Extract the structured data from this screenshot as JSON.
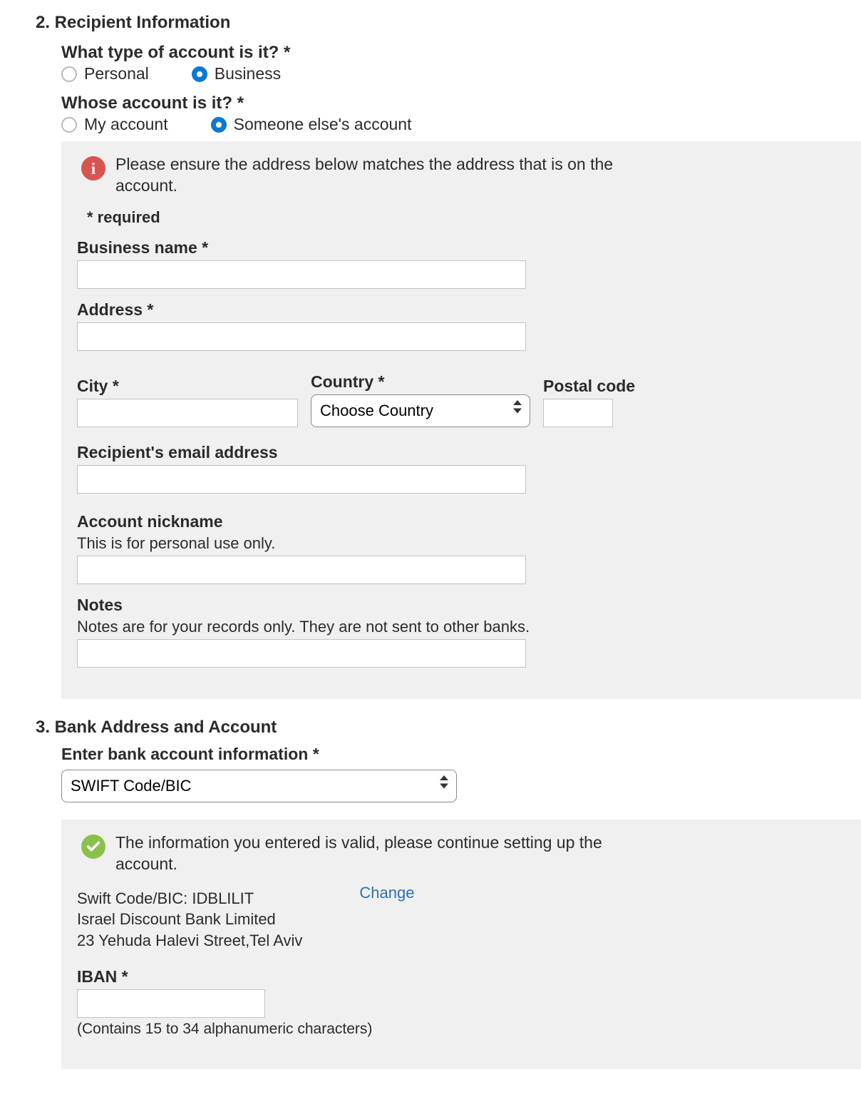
{
  "section2": {
    "title": "2. Recipient Information",
    "account_type": {
      "label": "What type of account is it? *",
      "option_personal": "Personal",
      "option_business": "Business"
    },
    "whose_account": {
      "label": "Whose account is it? *",
      "option_mine": "My account",
      "option_someone": "Someone else's account"
    },
    "info_note": "Please ensure the address below matches the address that is on the account.",
    "required_tag": "* required",
    "business_name": {
      "label": "Business name *",
      "value": ""
    },
    "address": {
      "label": "Address *",
      "value": ""
    },
    "city": {
      "label": "City *",
      "value": ""
    },
    "country": {
      "label": "Country *",
      "placeholder": "Choose Country"
    },
    "postal": {
      "label": "Postal code",
      "value": ""
    },
    "email": {
      "label": "Recipient's email address",
      "value": ""
    },
    "nickname": {
      "label": "Account nickname",
      "hint": "This is for personal use only.",
      "value": ""
    },
    "notes": {
      "label": "Notes",
      "hint": "Notes are for your records only. They are not sent to other banks.",
      "value": ""
    }
  },
  "section3": {
    "title": "3. Bank Address and Account",
    "bank_info_label": "Enter bank account information *",
    "bank_info_selected": "SWIFT Code/BIC",
    "valid_note": "The information you entered is valid, please continue setting up the account.",
    "swift_line": "Swift Code/BIC: IDBLILIT",
    "bank_name": "Israel Discount Bank Limited",
    "bank_address": "23 Yehuda Halevi Street,Tel Aviv",
    "change_label": "Change",
    "iban": {
      "label": "IBAN *",
      "hint": "(Contains 15 to 34 alphanumeric characters)",
      "value": ""
    }
  }
}
